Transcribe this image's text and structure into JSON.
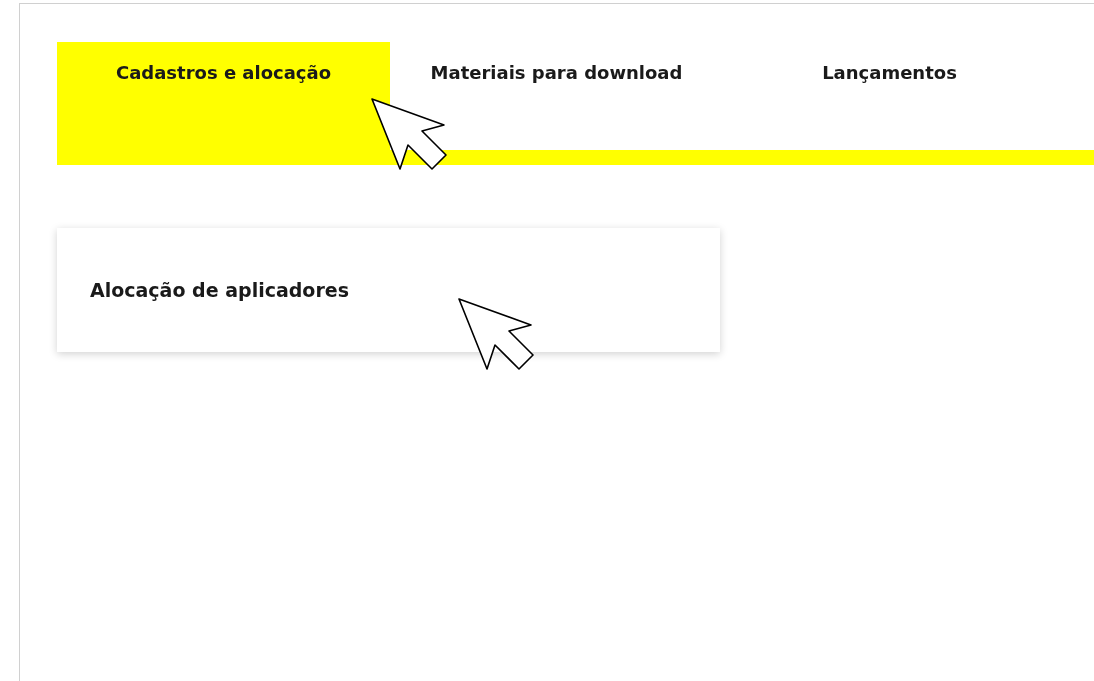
{
  "tabs": [
    {
      "label": "Cadastros e alocação",
      "selected": true
    },
    {
      "label": "Materiais para download",
      "selected": false
    },
    {
      "label": "Lançamentos",
      "selected": false
    }
  ],
  "cards": [
    {
      "title": "Alocação de aplicadores"
    }
  ]
}
